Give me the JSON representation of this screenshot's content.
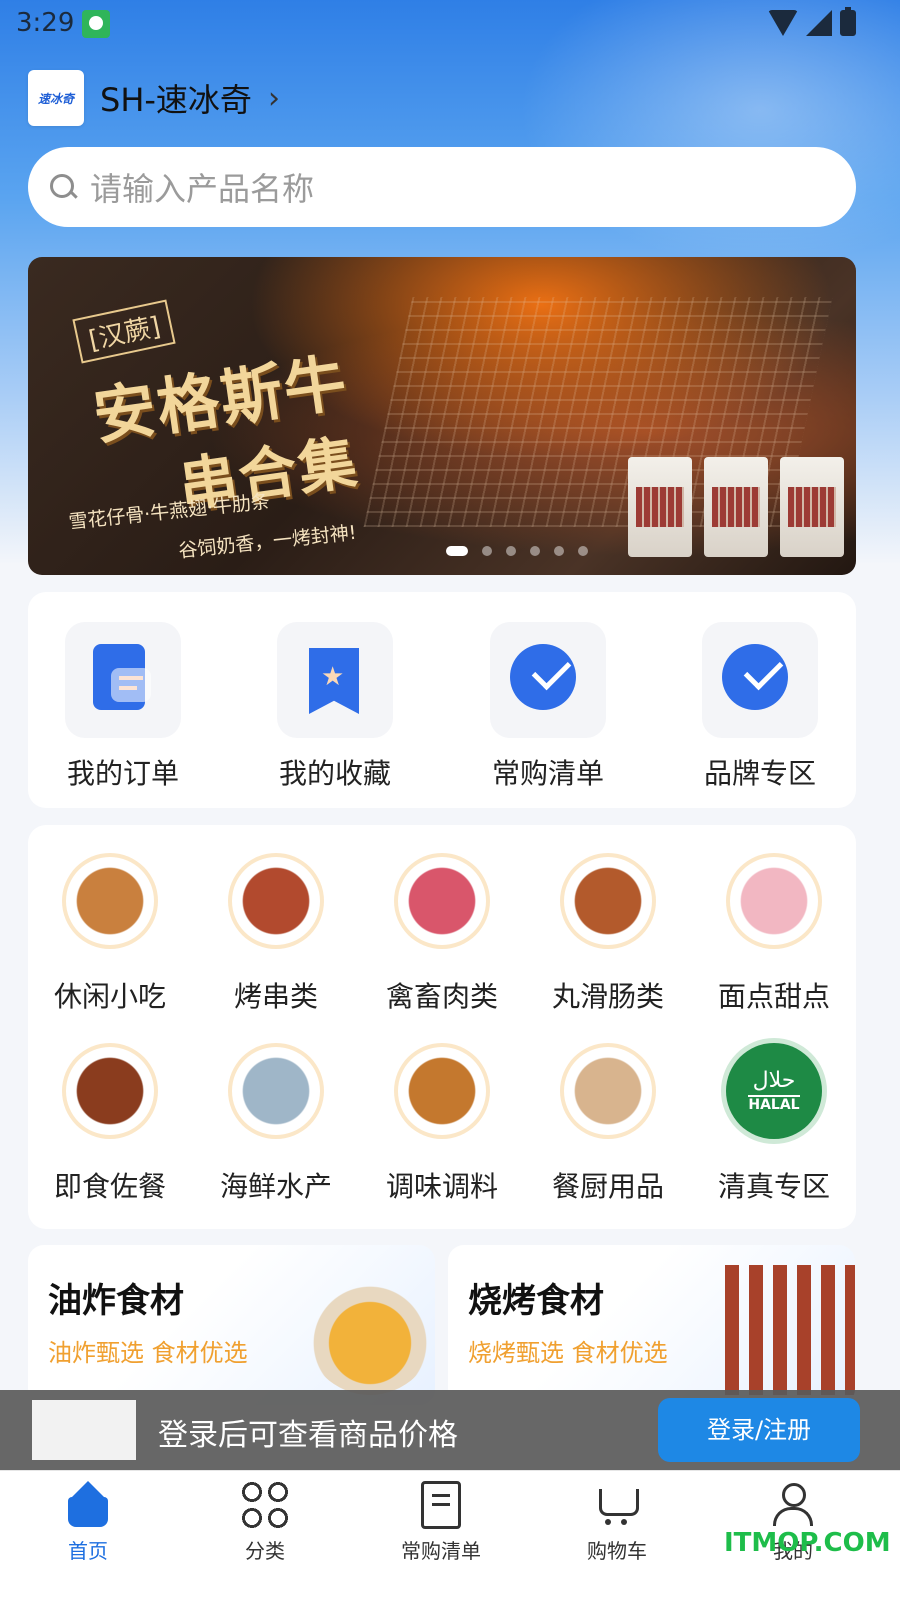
{
  "status": {
    "time": "3:29"
  },
  "store": {
    "logo_text": "速冰奇",
    "name": "SH-速冰奇",
    "chevron": "›"
  },
  "search": {
    "placeholder": "请输入产品名称"
  },
  "banner": {
    "brand": "[汉蕨]",
    "headline_line1": "安格斯牛",
    "headline_line2": "串合集",
    "subtitle_line1": "雪花仔骨·牛燕翅·牛肋条",
    "subtitle_line2": "谷饲奶香，一烤封神!",
    "dots_count": 6,
    "active_dot": 0
  },
  "quick_actions": [
    {
      "label": "我的订单",
      "icon": "order-icon"
    },
    {
      "label": "我的收藏",
      "icon": "favorite-icon"
    },
    {
      "label": "常购清单",
      "icon": "checklist-icon"
    },
    {
      "label": "品牌专区",
      "icon": "brand-icon"
    }
  ],
  "categories": [
    {
      "label": "休闲小吃",
      "icon": "snack-icon",
      "color": "#c9803e"
    },
    {
      "label": "烤串类",
      "icon": "skewer-icon",
      "color": "#b24a2e"
    },
    {
      "label": "禽畜肉类",
      "icon": "meat-icon",
      "color": "#d9566b"
    },
    {
      "label": "丸滑肠类",
      "icon": "meatball-icon",
      "color": "#b35a2c"
    },
    {
      "label": "面点甜点",
      "icon": "dessert-icon",
      "color": "#f2b7c2"
    },
    {
      "label": "即食佐餐",
      "icon": "ready-meal-icon",
      "color": "#8a3c1e"
    },
    {
      "label": "海鲜水产",
      "icon": "shrimp-icon",
      "color": "#9fb6c8"
    },
    {
      "label": "调味调料",
      "icon": "spice-icon",
      "color": "#c4782e"
    },
    {
      "label": "餐厨用品",
      "icon": "chopsticks-icon",
      "color": "#d8b48e"
    },
    {
      "label": "清真专区",
      "icon": "halal-icon",
      "color": "#1e8a45",
      "badge_ar": "حلال",
      "badge_en": "HALAL"
    }
  ],
  "promos": [
    {
      "title": "油炸食材",
      "subtitle": "油炸甄选 食材优选",
      "icon": "fried-food-icon"
    },
    {
      "title": "烧烤食材",
      "subtitle": "烧烤甄选 食材优选",
      "icon": "bbq-skewer-icon"
    }
  ],
  "login_bar": {
    "message": "登录后可查看商品价格",
    "button": "登录/注册"
  },
  "tabs": [
    {
      "label": "首页",
      "icon": "home-icon",
      "active": true
    },
    {
      "label": "分类",
      "icon": "category-icon",
      "active": false
    },
    {
      "label": "常购清单",
      "icon": "checklist-icon",
      "active": false
    },
    {
      "label": "购物车",
      "icon": "cart-icon",
      "active": false
    },
    {
      "label": "我的",
      "icon": "user-icon",
      "active": false
    }
  ],
  "watermark": "ITMOP.COM",
  "colors": {
    "accent": "#1e6fe0",
    "promo_sub": "#f0a030",
    "login_button": "#1e88e5"
  }
}
